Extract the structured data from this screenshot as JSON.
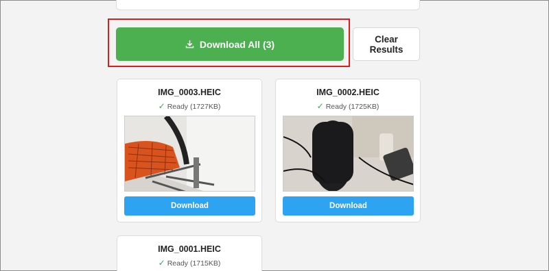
{
  "actions": {
    "download_all_label": "Download All (3)",
    "clear_label": "Clear Results"
  },
  "results": [
    {
      "filename": "IMG_0003.HEIC",
      "status": "Ready (1727KB)",
      "button": "Download"
    },
    {
      "filename": "IMG_0002.HEIC",
      "status": "Ready (1725KB)",
      "button": "Download"
    },
    {
      "filename": "IMG_0001.HEIC",
      "status": "Ready (1715KB)"
    }
  ],
  "colors": {
    "primary_green": "#4caf50",
    "download_blue": "#2ea3f2",
    "highlight_red": "#e01b1b",
    "ready_check": "#3aa65a"
  }
}
